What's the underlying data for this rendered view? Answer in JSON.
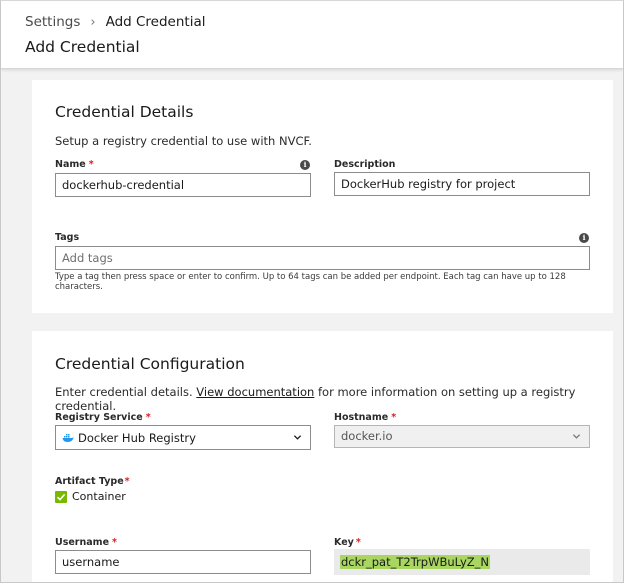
{
  "breadcrumb": {
    "parent": "Settings",
    "separator": "›",
    "current": "Add Credential"
  },
  "page_title": "Add Credential",
  "credential_details": {
    "title": "Credential Details",
    "subtitle": "Setup a registry credential to use with NVCF.",
    "name_label": "Name",
    "required_marker": "*",
    "name_value": "dockerhub-credential",
    "description_label": "Description",
    "description_value": "DockerHub registry for project",
    "tags_label": "Tags",
    "tags_placeholder": "Add tags",
    "tags_help_line1": "Type a tag then press space or enter to confirm. Up to 64 tags can be added per endpoint. Each tag can have up to 128",
    "tags_help_line2": "characters."
  },
  "credential_configuration": {
    "title": "Credential Configuration",
    "subtitle_prefix": "Enter credential details. ",
    "subtitle_link": "View documentation",
    "subtitle_suffix": " for more information on setting up a registry credential.",
    "registry_label": "Registry Service",
    "registry_value": "Docker Hub Registry",
    "hostname_label": "Hostname",
    "hostname_value": "docker.io",
    "artifact_label": "Artifact Type",
    "artifact_option": "Container",
    "artifact_checked": true,
    "username_label": "Username",
    "username_value": "username",
    "key_label": "Key",
    "key_value": "dckr_pat_T2TrpWBuLyZ_N"
  },
  "icons": {
    "info": "info-icon",
    "docker": "docker-whale-icon",
    "chevron": "chevron-down-icon",
    "check": "checkmark-icon"
  },
  "colors": {
    "accent_green": "#76b900",
    "highlight": "#a8d660",
    "required_red": "#d62020"
  }
}
